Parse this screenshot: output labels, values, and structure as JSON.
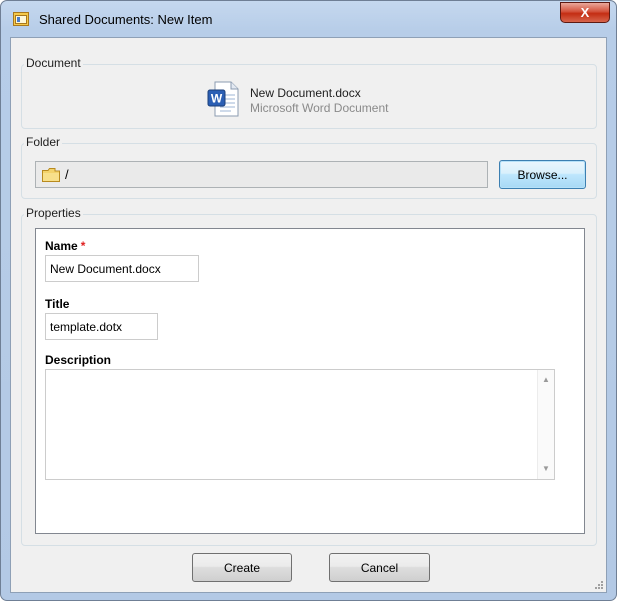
{
  "window": {
    "title": "Shared Documents: New Item",
    "close_label": "X"
  },
  "document": {
    "group_label": "Document",
    "file_name": "New Document.docx",
    "file_type": "Microsoft Word Document",
    "icon": "word-document-icon"
  },
  "folder": {
    "group_label": "Folder",
    "path": "/",
    "icon": "folder-icon",
    "browse_label": "Browse..."
  },
  "properties": {
    "group_label": "Properties",
    "name_label": "Name",
    "required_mark": "*",
    "name_value": "New Document.docx",
    "title_label": "Title",
    "title_value": "template.dotx",
    "description_label": "Description",
    "description_value": ""
  },
  "actions": {
    "create_label": "Create",
    "cancel_label": "Cancel"
  },
  "colors": {
    "title_bar": "#b7cde8",
    "client_bg": "#f0f0f0",
    "close_button": "#c42d13",
    "required": "#e02020",
    "browse_focus_border": "#3c7fb1"
  }
}
